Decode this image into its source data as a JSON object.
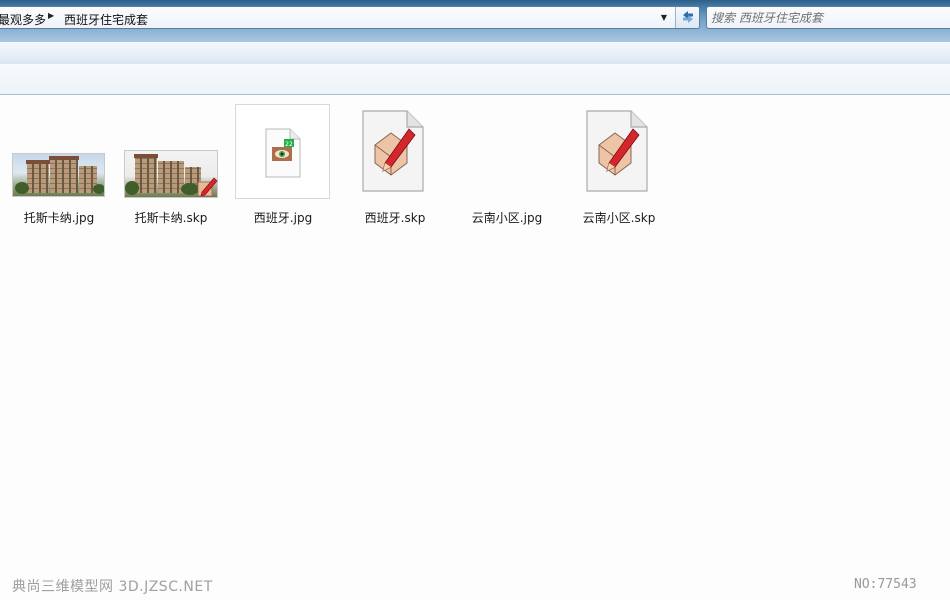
{
  "address": {
    "breadcrumb": [
      "最观多多",
      "西班牙住宅成套"
    ]
  },
  "search": {
    "placeholder": "搜索 西班牙住宅成套"
  },
  "files": [
    {
      "name": "托斯卡纳.jpg",
      "type": "photo-thumbnail"
    },
    {
      "name": "托斯卡纳.skp",
      "type": "photo-thumbnail-skp"
    },
    {
      "name": "西班牙.jpg",
      "type": "image-file-icon"
    },
    {
      "name": "西班牙.skp",
      "type": "sketchup-file-icon"
    },
    {
      "name": "云南小区.jpg",
      "type": "blank"
    },
    {
      "name": "云南小区.skp",
      "type": "sketchup-file-icon"
    }
  ],
  "overlay": {
    "watermark": "典尚三维模型网 3D.JZSC.NET",
    "number": "NO:77543"
  },
  "icons": {
    "dropdown": "chevron-down-icon",
    "refresh": "refresh-icon",
    "breadcrumb_sep": "chevron-right-icon"
  }
}
